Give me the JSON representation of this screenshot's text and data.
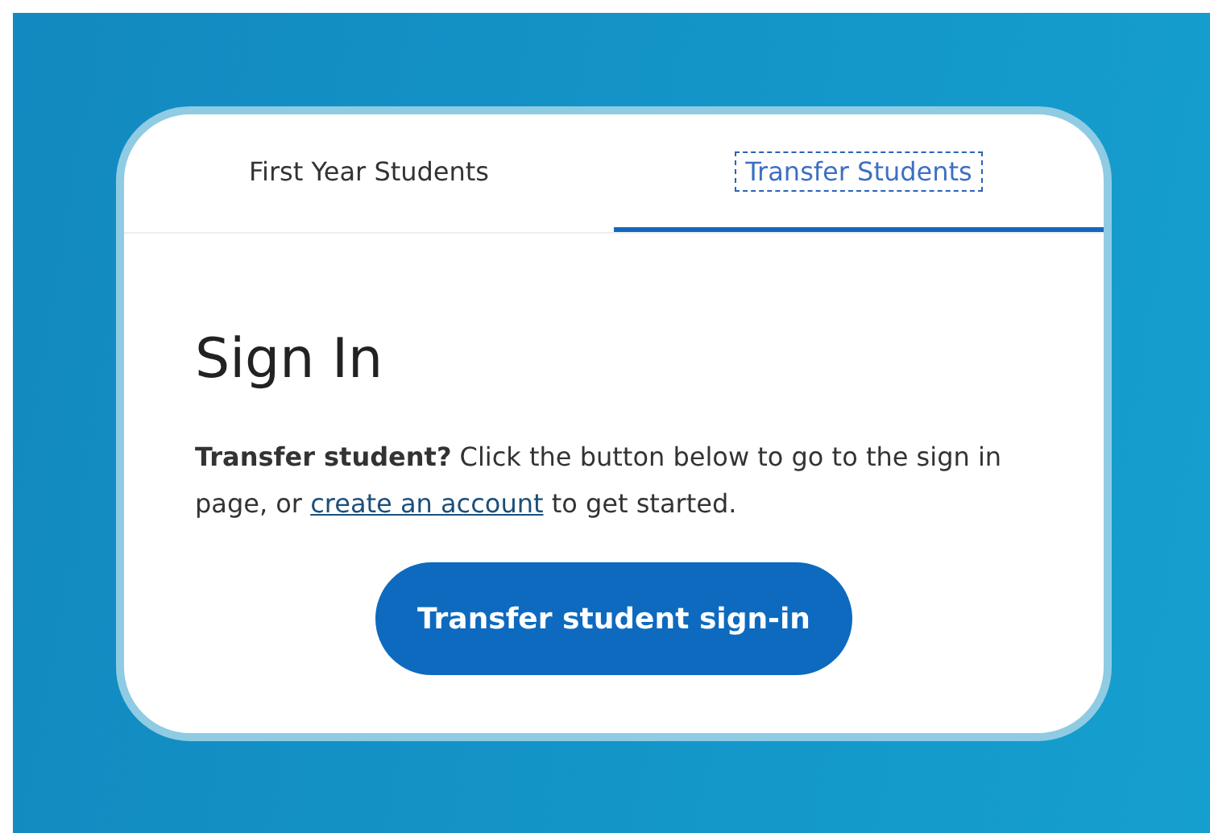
{
  "tabs": [
    {
      "label": "First Year Students",
      "selected": false
    },
    {
      "label": "Transfer Students",
      "selected": true
    }
  ],
  "heading": "Sign In",
  "message": {
    "text": "**Transfer student?** Click the button below to go to the sign in page, or ",
    "link": "create an account",
    "after": " to get started."
  },
  "button": "Transfer student sign-in"
}
